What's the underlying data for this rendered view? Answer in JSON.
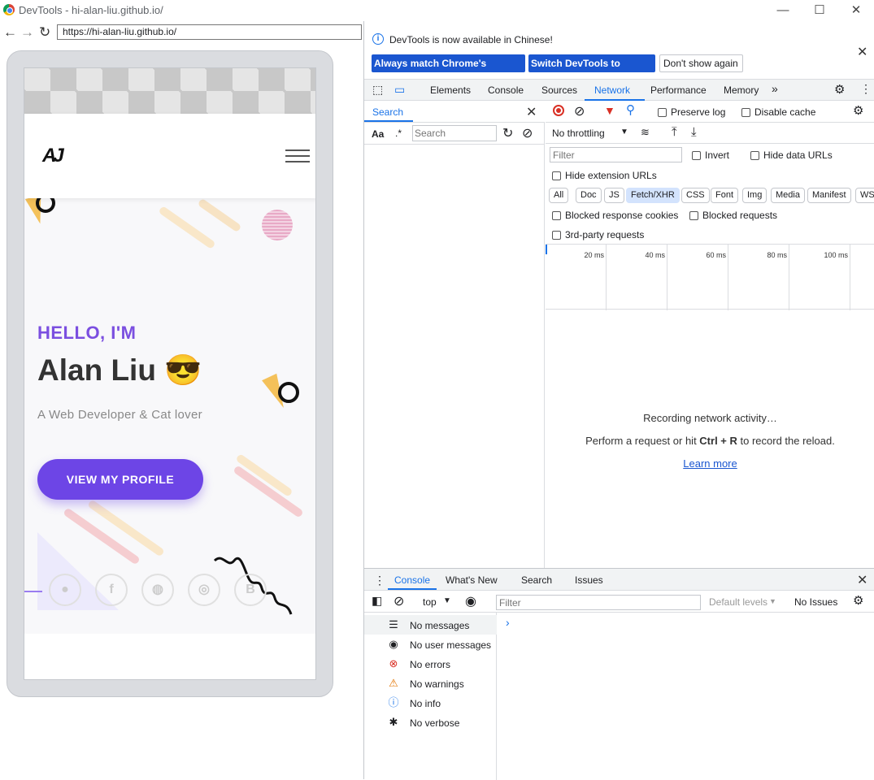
{
  "window": {
    "title": "DevTools - hi-alan-liu.github.io/",
    "minimize": "—",
    "maximize": "☐",
    "close": "✕"
  },
  "address": {
    "url": "https://hi-alan-liu.github.io/"
  },
  "site": {
    "logo": "AJ",
    "hello": "HELLO, I'M",
    "name": "Alan Liu 😎",
    "tagline": "A Web Developer & Cat lover",
    "profile_button": "VIEW MY PROFILE",
    "socials": [
      "github",
      "facebook",
      "line",
      "instagram",
      "blogger"
    ]
  },
  "infobar": {
    "message": "DevTools is now available in Chinese!",
    "btn_match": "Always match Chrome's language",
    "btn_switch": "Switch DevTools to Chinese",
    "btn_dont": "Don't show again"
  },
  "tabs": [
    "Elements",
    "Console",
    "Sources",
    "Network",
    "Performance",
    "Memory"
  ],
  "active_tab": "Network",
  "search": {
    "tab": "Search",
    "aa": "Aa",
    "regex": ".*",
    "placeholder": "Search"
  },
  "network": {
    "preserve_log": "Preserve log",
    "disable_cache": "Disable cache",
    "throttling": "No throttling",
    "filter_placeholder": "Filter",
    "invert": "Invert",
    "hide_data_urls": "Hide data URLs",
    "hide_extension_urls": "Hide extension URLs",
    "chips": [
      "All",
      "Doc",
      "JS",
      "Fetch/XHR",
      "CSS",
      "Font",
      "Img",
      "Media",
      "Manifest",
      "WS"
    ],
    "active_chip": "Fetch/XHR",
    "blocked_cookies": "Blocked response cookies",
    "blocked_requests": "Blocked requests",
    "third_party": "3rd-party requests",
    "ticks": [
      "20 ms",
      "40 ms",
      "60 ms",
      "80 ms",
      "100 ms"
    ],
    "recording": "Recording network activity…",
    "perform_pre": "Perform a request or hit ",
    "perform_keys": "Ctrl + R",
    "perform_post": " to record the reload.",
    "learn_more": "Learn more"
  },
  "drawer": {
    "tabs": [
      "Console",
      "What's New",
      "Search",
      "Issues"
    ],
    "context": "top",
    "filter_placeholder": "Filter",
    "levels": "Default levels",
    "issues": "No Issues",
    "prompt": "›",
    "sidebar": [
      {
        "icon": "list-icon",
        "glyph": "☰",
        "label": "No messages",
        "color": "#333"
      },
      {
        "icon": "user-icon",
        "glyph": "◉",
        "label": "No user messages",
        "color": "#333"
      },
      {
        "icon": "error-icon",
        "glyph": "⊗",
        "label": "No errors",
        "color": "#d93025"
      },
      {
        "icon": "warning-icon",
        "glyph": "⚠",
        "label": "No warnings",
        "color": "#e37400"
      },
      {
        "icon": "info-icon",
        "glyph": "ⓘ",
        "label": "No info",
        "color": "#1a73e8"
      },
      {
        "icon": "bug-icon",
        "glyph": "✱",
        "label": "No verbose",
        "color": "#333"
      }
    ]
  }
}
